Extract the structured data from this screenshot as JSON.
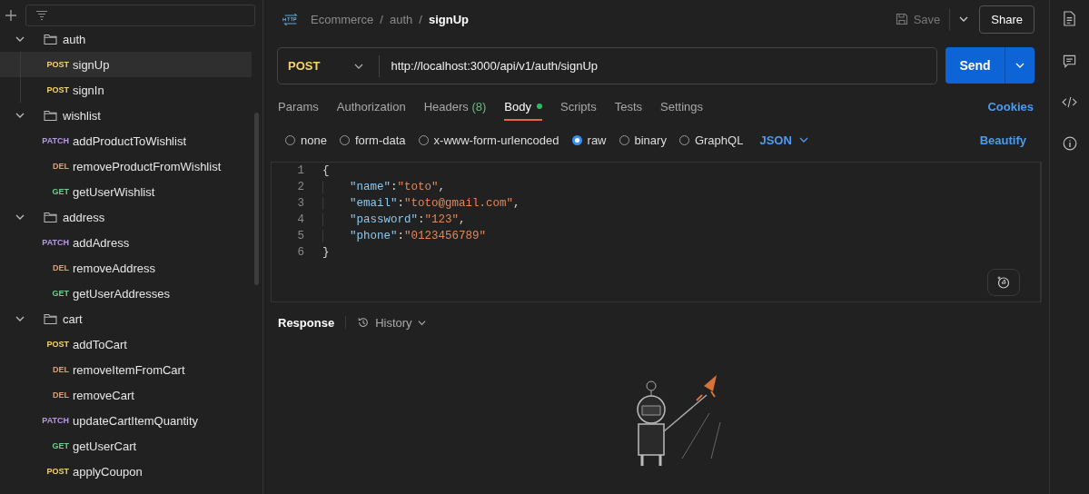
{
  "sidebar": {
    "tree": [
      {
        "name": "auth",
        "expanded": true,
        "children": [
          {
            "method": "POST",
            "kind": "post",
            "name": "signUp",
            "selected": true
          },
          {
            "method": "POST",
            "kind": "post",
            "name": "signIn",
            "selected": false
          }
        ]
      },
      {
        "name": "wishlist",
        "expanded": true,
        "children": [
          {
            "method": "PATCH",
            "kind": "patch",
            "name": "addProductToWishlist",
            "selected": false
          },
          {
            "method": "DEL",
            "kind": "delete",
            "name": "removeProductFromWishlist",
            "selected": false
          },
          {
            "method": "GET",
            "kind": "get",
            "name": "getUserWishlist",
            "selected": false
          }
        ]
      },
      {
        "name": "address",
        "expanded": true,
        "children": [
          {
            "method": "PATCH",
            "kind": "patch",
            "name": "addAdress",
            "selected": false
          },
          {
            "method": "DEL",
            "kind": "delete",
            "name": "removeAddress",
            "selected": false
          },
          {
            "method": "GET",
            "kind": "get",
            "name": "getUserAddresses",
            "selected": false
          }
        ]
      },
      {
        "name": "cart",
        "expanded": true,
        "children": [
          {
            "method": "POST",
            "kind": "post",
            "name": "addToCart",
            "selected": false
          },
          {
            "method": "DEL",
            "kind": "delete",
            "name": "removeItemFromCart",
            "selected": false
          },
          {
            "method": "DEL",
            "kind": "delete",
            "name": "removeCart",
            "selected": false
          },
          {
            "method": "PATCH",
            "kind": "patch",
            "name": "updateCartItemQuantity",
            "selected": false
          },
          {
            "method": "GET",
            "kind": "get",
            "name": "getUserCart",
            "selected": false
          },
          {
            "method": "POST",
            "kind": "post",
            "name": "applyCoupon",
            "selected": false
          }
        ]
      }
    ]
  },
  "breadcrumb": {
    "items": [
      "Ecommerce",
      "auth",
      "signUp"
    ],
    "separators": [
      "/",
      "/"
    ]
  },
  "save": {
    "label": "Save",
    "disabled": true
  },
  "share": "Share",
  "request": {
    "method": "POST",
    "url": "http://localhost:3000/api/v1/auth/signUp",
    "send": "Send"
  },
  "tabs": [
    {
      "label": "Params",
      "selected": false
    },
    {
      "label": "Authorization",
      "selected": false
    },
    {
      "label": "Headers",
      "count": "(8)",
      "selected": false
    },
    {
      "label": "Body",
      "modified": true,
      "selected": true
    },
    {
      "label": "Scripts",
      "selected": false
    },
    {
      "label": "Tests",
      "selected": false
    },
    {
      "label": "Settings",
      "selected": false
    }
  ],
  "cookies": "Cookies",
  "body_modes": [
    {
      "label": "none",
      "selected": false
    },
    {
      "label": "form-data",
      "selected": false
    },
    {
      "label": "x-www-form-urlencoded",
      "selected": false
    },
    {
      "label": "raw",
      "selected": true
    },
    {
      "label": "binary",
      "selected": false
    },
    {
      "label": "GraphQL",
      "selected": false
    }
  ],
  "format": "JSON",
  "beautify": "Beautify",
  "code": [
    {
      "number": "1",
      "indent": false,
      "tokens": [
        {
          "kind": "punct",
          "text": "{"
        }
      ]
    },
    {
      "number": "2",
      "indent": true,
      "tokens": [
        {
          "kind": "key",
          "text": "\"name\""
        },
        {
          "kind": "punct",
          "text": ":"
        },
        {
          "kind": "string",
          "text": "\"toto\""
        },
        {
          "kind": "punct",
          "text": ","
        }
      ]
    },
    {
      "number": "3",
      "indent": true,
      "tokens": [
        {
          "kind": "key",
          "text": "\"email\""
        },
        {
          "kind": "punct",
          "text": ":"
        },
        {
          "kind": "string",
          "text": "\"toto@gmail.com\""
        },
        {
          "kind": "punct",
          "text": ","
        }
      ]
    },
    {
      "number": "4",
      "indent": true,
      "tokens": [
        {
          "kind": "key",
          "text": "\"password\""
        },
        {
          "kind": "punct",
          "text": ":"
        },
        {
          "kind": "string",
          "text": "\"123\""
        },
        {
          "kind": "punct",
          "text": ","
        }
      ]
    },
    {
      "number": "5",
      "indent": true,
      "tokens": [
        {
          "kind": "key",
          "text": "\"phone\""
        },
        {
          "kind": "punct",
          "text": ":"
        },
        {
          "kind": "string",
          "text": "\"0123456789\""
        }
      ]
    },
    {
      "number": "6",
      "indent": false,
      "tokens": [
        {
          "kind": "punct",
          "text": "}"
        }
      ]
    }
  ],
  "response": {
    "title": "Response",
    "history": "History"
  }
}
